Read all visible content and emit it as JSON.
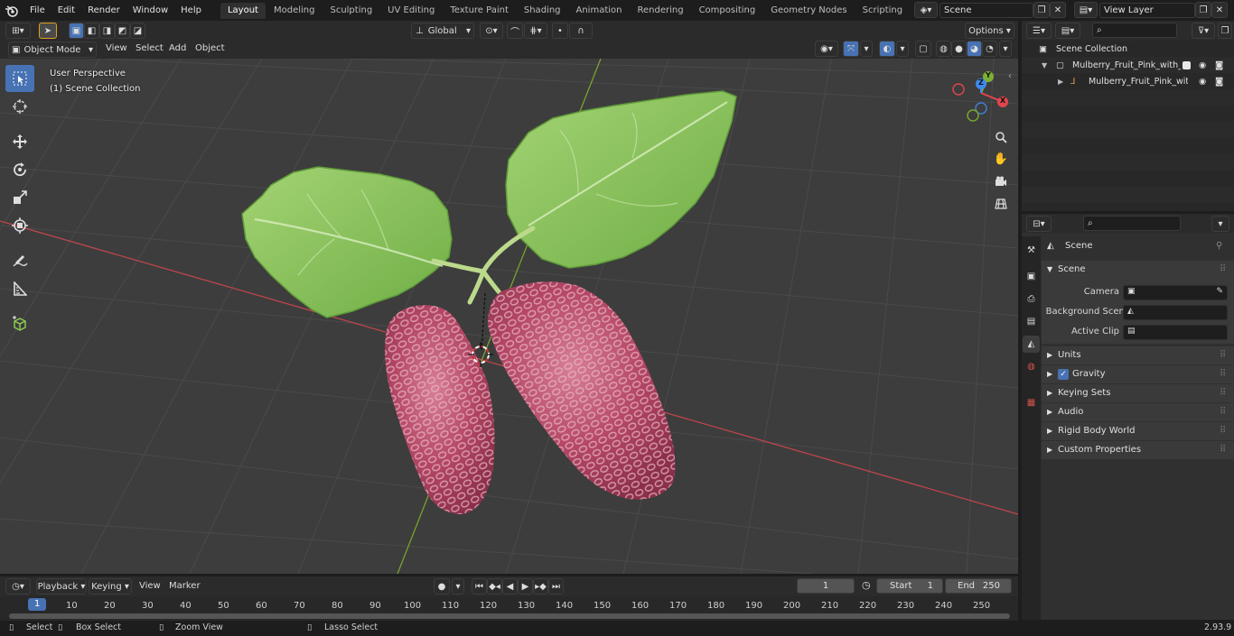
{
  "menus": [
    "File",
    "Edit",
    "Render",
    "Window",
    "Help"
  ],
  "workspaces": [
    "Layout",
    "Modeling",
    "Sculpting",
    "UV Editing",
    "Texture Paint",
    "Shading",
    "Animation",
    "Rendering",
    "Compositing",
    "Geometry Nodes",
    "Scripting"
  ],
  "active_workspace": "Layout",
  "scene_field": "Scene",
  "view_layer_field": "View Layer",
  "viewport_header": {
    "mode": "Object Mode",
    "menu": [
      "View",
      "Select",
      "Add",
      "Object"
    ],
    "orientation": "Global",
    "options": "Options"
  },
  "viewport_overlay": {
    "perspective": "User Perspective",
    "collection": "(1) Scene Collection"
  },
  "gizmo": {
    "y_label": "Y",
    "x_label": "X",
    "z_label": "Z"
  },
  "outliner": {
    "search_placeholder": "",
    "root": "Scene Collection",
    "items": [
      {
        "label": "Mulberry_Fruit_Pink_with_Lea"
      },
      {
        "label": "Mulberry_Fruit_Pink_with"
      }
    ]
  },
  "properties": {
    "search_placeholder": "",
    "context": "Scene",
    "panel_title": "Scene",
    "fields": [
      {
        "label": "Camera"
      },
      {
        "label": "Background Scene"
      },
      {
        "label": "Active Clip"
      }
    ],
    "subpanels": [
      "Units",
      "Gravity",
      "Keying Sets",
      "Audio",
      "Rigid Body World",
      "Custom Properties"
    ],
    "gravity_checked": true
  },
  "timeline": {
    "menu": [
      "Playback",
      "Keying",
      "View",
      "Marker"
    ],
    "current_frame": "1",
    "start_label": "Start",
    "start": "1",
    "end_label": "End",
    "end": "250",
    "ruler": [
      "1",
      "10",
      "20",
      "30",
      "40",
      "50",
      "60",
      "70",
      "80",
      "90",
      "100",
      "110",
      "120",
      "130",
      "140",
      "150",
      "160",
      "170",
      "180",
      "190",
      "200",
      "210",
      "220",
      "230",
      "240",
      "250"
    ]
  },
  "statusbar": {
    "select": "Select",
    "box_select": "Box Select",
    "zoom_view": "Zoom View",
    "lasso_select": "Lasso Select",
    "version": "2.93.9"
  },
  "colors": {
    "accent": "#4772b3",
    "viewport_bg": "#3d3d3d",
    "x_axis": "#d8464c",
    "y_axis": "#78a22d",
    "leaf": "#86c25a",
    "berry": "#b0405e"
  }
}
